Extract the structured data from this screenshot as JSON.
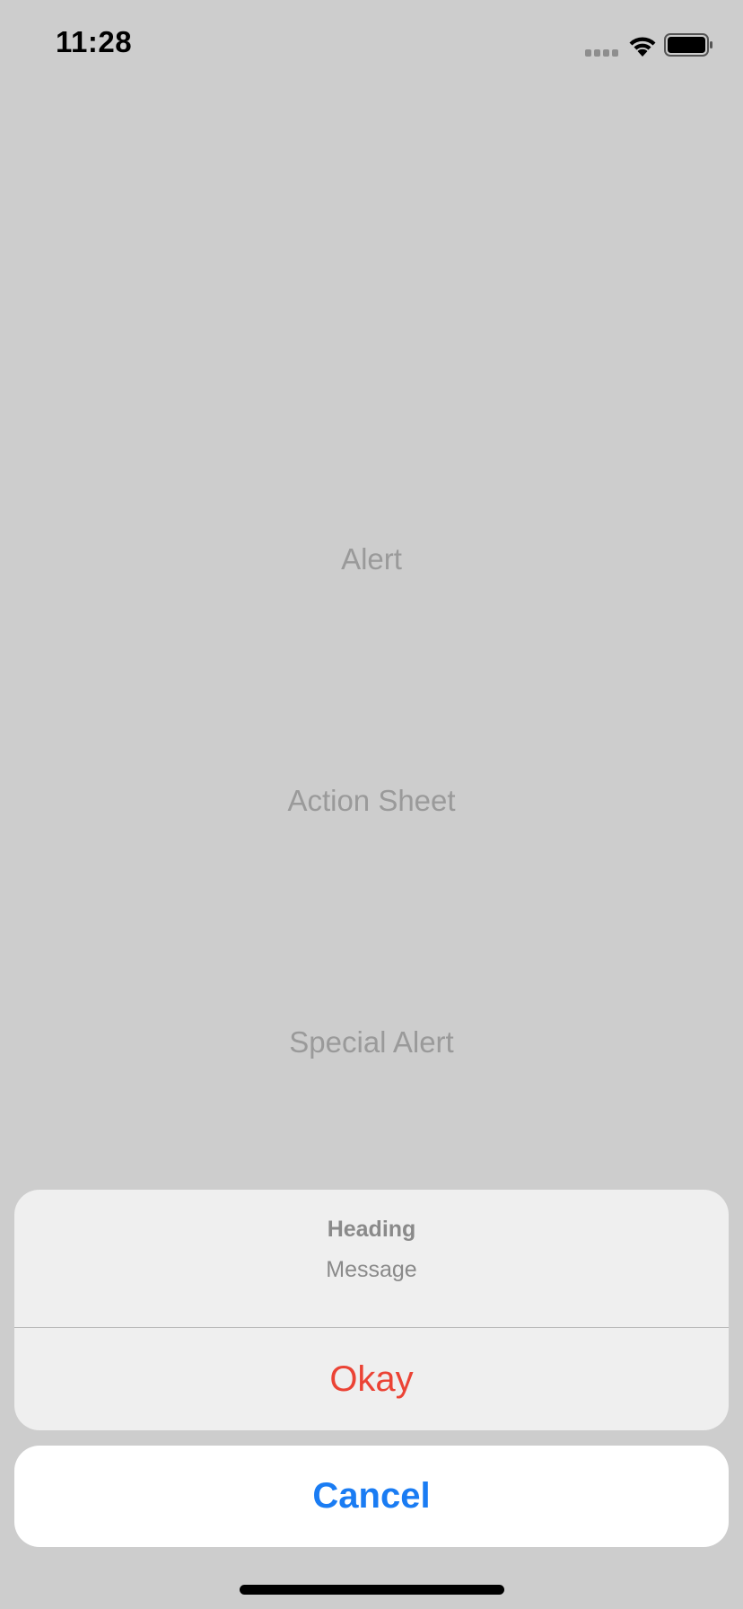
{
  "status_bar": {
    "time": "11:28",
    "icons": [
      "cellular-signal-icon",
      "wifi-icon",
      "battery-icon"
    ]
  },
  "menu": {
    "items": [
      {
        "label": "Alert"
      },
      {
        "label": "Action Sheet"
      },
      {
        "label": "Special Alert"
      }
    ]
  },
  "action_sheet": {
    "heading": "Heading",
    "message": "Message",
    "actions": [
      {
        "label": "Okay",
        "style": "destructive",
        "color": "#eb4335"
      }
    ],
    "cancel_label": "Cancel",
    "cancel_color": "#1a7cf3"
  }
}
